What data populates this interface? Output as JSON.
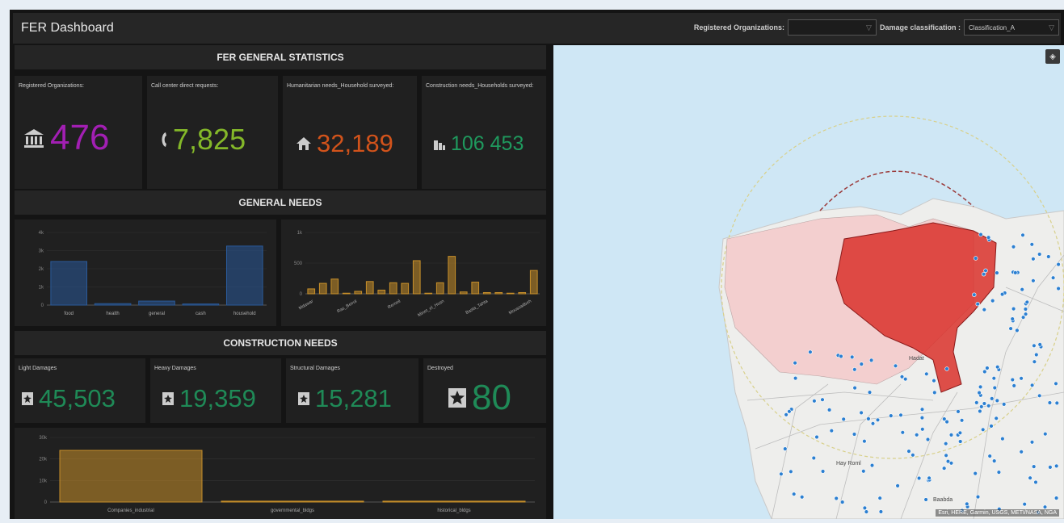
{
  "header": {
    "title": "FER Dashboard",
    "filter_org_label": "Registered Organizations:",
    "filter_org_value": "",
    "filter_damage_label": "Damage classification :",
    "filter_damage_value": "Classification_A"
  },
  "general_stats": {
    "title": "FER GENERAL STATISTICS",
    "cards": [
      {
        "label": "Registered Organizations:",
        "value": "476",
        "color": "#a21fb3",
        "icon": "building-columns-icon"
      },
      {
        "label": "Call center direct requests:",
        "value": "7,825",
        "color": "#84b829",
        "icon": "phone-icon"
      },
      {
        "label": "Humanitarian needs_Household surveyed:",
        "value": "32,189",
        "color": "#d2531b",
        "icon": "house-icon"
      },
      {
        "label": "Construction needs_Households surveyed:",
        "value": "106 453",
        "color": "#1f9a5e",
        "icon": "city-icon"
      }
    ]
  },
  "general_needs": {
    "title": "GENERAL NEEDS"
  },
  "construction": {
    "title": "CONSTRUCTION NEEDS",
    "cards": [
      {
        "label": "Light Damages",
        "value": "45,503",
        "color": "#1f8a57",
        "icon": "damage-icon"
      },
      {
        "label": "Heavy Damages",
        "value": "19,359",
        "color": "#1f8a57",
        "icon": "damage-icon"
      },
      {
        "label": "Structural Damages",
        "value": "15,281",
        "color": "#1f8a57",
        "icon": "damage-icon"
      },
      {
        "label": "Destroyed",
        "value": "80",
        "color": "#1f8a57",
        "icon": "destroyed-icon"
      }
    ]
  },
  "chart_data": [
    {
      "type": "bar",
      "categories": [
        "food",
        "health",
        "general",
        "cash",
        "household"
      ],
      "values": [
        2400,
        80,
        220,
        60,
        3250
      ],
      "ylim": [
        0,
        4000
      ],
      "yticks": [
        "0",
        "1k",
        "2k",
        "3k",
        "4k"
      ],
      "color": "#2a5a9a"
    },
    {
      "type": "bar",
      "categories": [
        "Mdawar",
        "",
        "Ras_Beirut",
        "",
        "",
        "Remeil",
        "",
        "",
        "",
        "Minet_el_Hosn",
        "",
        "",
        "",
        "Bachoura",
        "",
        "Saifeh",
        "",
        "",
        "",
        "Moussaitbeh"
      ],
      "labels_shown": [
        "Mdawar",
        "Ras_Beirut",
        "Remeil",
        "Minet_el_Hosn",
        "Basta_Tahta",
        "Moussaitbeh"
      ],
      "values": [
        80,
        170,
        240,
        10,
        40,
        200,
        60,
        180,
        170,
        540,
        10,
        180,
        610,
        30,
        190,
        20,
        20,
        10,
        20,
        380
      ],
      "ylim": [
        0,
        1000
      ],
      "yticks": [
        "0",
        "500",
        "1k"
      ],
      "color": "#c8902a"
    },
    {
      "type": "bar",
      "categories": [
        "Companies_industrial",
        "governmental_bldgs",
        "historical_bldgs"
      ],
      "values": [
        24000,
        400,
        400
      ],
      "ylim": [
        0,
        30000
      ],
      "yticks": [
        "0",
        "10k",
        "20k",
        "30k"
      ],
      "color": "#c8902a"
    }
  ],
  "map": {
    "layers_button": "layers-icon",
    "attribution": "Esri, HERE, Garmin, USGS, METI/NASA, NGA",
    "colors": {
      "water": "#cfe7f5",
      "land": "#eeeeec",
      "district": "#f3cfcf",
      "damage": "#d9312b",
      "points": "#2b7fd1"
    }
  }
}
